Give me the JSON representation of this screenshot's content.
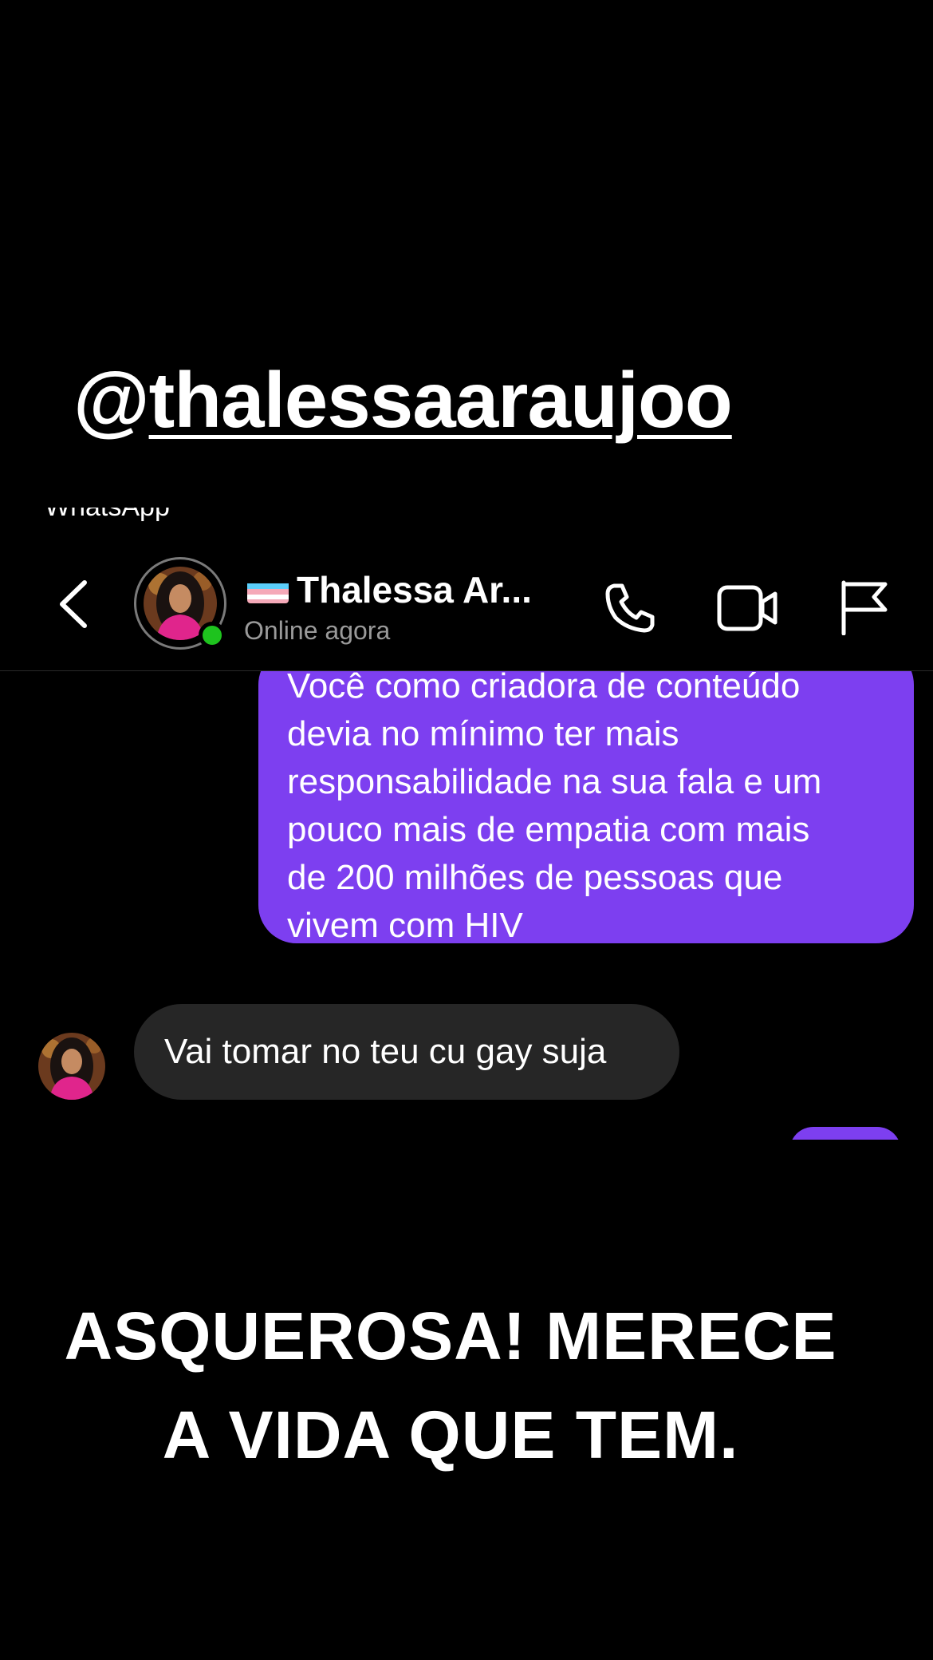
{
  "story": {
    "mention_at": "@",
    "mention_handle": "thalessaaraujoo",
    "cutoff_label": "WhatsApp",
    "caption_line1": "ASQUEROSA! MERECE",
    "caption_line2": "A VIDA QUE TEM."
  },
  "header": {
    "contact_name": "Thalessa Ar...",
    "status": "Online agora",
    "flag_icon": "transgender-flag-icon",
    "icons": [
      "back-arrow-icon",
      "phone-icon",
      "video-camera-icon",
      "report-flag-icon"
    ]
  },
  "messages": [
    {
      "direction": "outgoing",
      "lines": [
        "Você como criadora de conteúdo",
        "devia no mínimo ter mais",
        "responsabilidade na sua fala e um",
        "pouco mais de empatia com mais",
        "de 200 milhões de pessoas que",
        "vivem com HIV"
      ]
    },
    {
      "direction": "incoming",
      "text": "Vai tomar no teu cu gay suja"
    }
  ],
  "colors": {
    "background": "#000000",
    "outgoing_bubble": "#7d3ff0",
    "incoming_bubble": "#262626",
    "online_dot": "#1ec31e",
    "status_text": "#9a9a9a"
  }
}
